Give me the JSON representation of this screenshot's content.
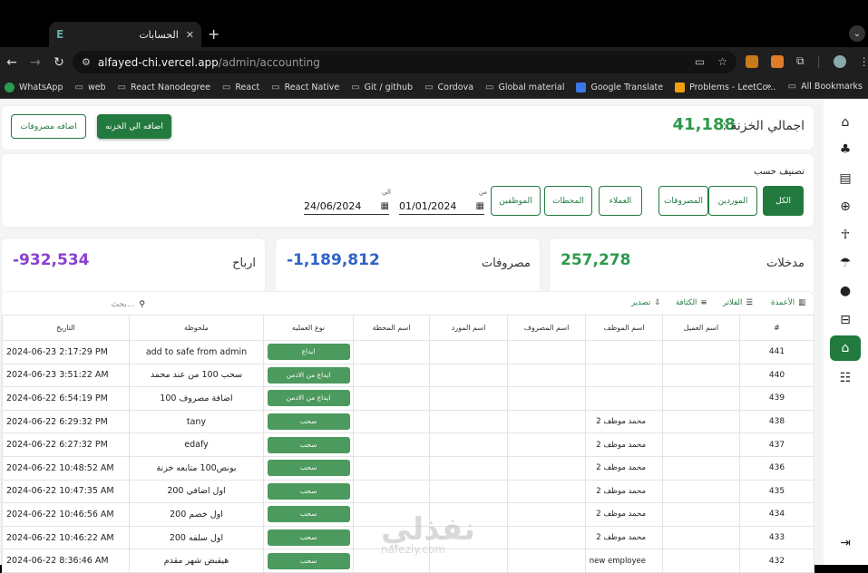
{
  "browser": {
    "tab_title": "الحسابات",
    "tab_favicon": "E",
    "url_host": "alfayed-chi.vercel.app",
    "url_path": "/admin/accounting",
    "bookmarks": [
      "WhatsApp",
      "web",
      "React Nanodegree",
      "React",
      "React Native",
      "Git / github",
      "Cordova",
      "Global material",
      "Google Translate",
      "Problems - LeetCo..."
    ],
    "all_bookmarks": "All Bookmarks"
  },
  "summary": {
    "total_label": "اجمالي الخزنة :",
    "total_value": "41,188",
    "add_treasury": "اضافه الي الخزنه",
    "add_expense": "اضافه مصروفات"
  },
  "filters": {
    "heading": "تصنيف حسب",
    "buttons": [
      "الكل",
      "الموردين",
      "المصروفات",
      "العملاء",
      "المحطات",
      "الموظفين"
    ],
    "from_label": "من",
    "from_date": "01/01/2024",
    "to_label": "الي",
    "to_date": "24/06/2024"
  },
  "stats": {
    "income_label": "مدخلات",
    "income_value": "257,278",
    "income_color": "#2e9a4c",
    "expenses_label": "مصروفات",
    "expenses_value": "-1,189,812",
    "expenses_color": "#2f63c8",
    "profit_label": "ارباح",
    "profit_value": "-932,534",
    "profit_color": "#8a3fd1"
  },
  "table_tools": {
    "columns": "الأعمدة",
    "filters": "الفلاتر",
    "density": "الكثافة",
    "export": "تصدير",
    "search_placeholder": "بحث..."
  },
  "table": {
    "headers": [
      "#",
      "اسم العميل",
      "اسم الموظف",
      "اسم المصروف",
      "اسم المورد",
      "اسم المحطة",
      "نوع العمليه",
      "ملحوظة",
      "التاريخ"
    ],
    "rows": [
      {
        "id": "441",
        "emp": "",
        "type": "ايداع",
        "note": "add to safe from admin",
        "date": "2024-06-23 2:17:29 PM"
      },
      {
        "id": "440",
        "emp": "",
        "type": "ايداع من الادمن",
        "note": "سحب 100 من عند محمد",
        "date": "2024-06-23 3:51:22 AM"
      },
      {
        "id": "439",
        "emp": "",
        "type": "ايداع من الادمن",
        "note": "اضافة مصروف 100",
        "date": "2024-06-22 6:54:19 PM"
      },
      {
        "id": "438",
        "emp": "محمد موظف 2",
        "type": "سحب",
        "note": "tany",
        "date": "2024-06-22 6:29:32 PM"
      },
      {
        "id": "437",
        "emp": "محمد موظف 2",
        "type": "سحب",
        "note": "edafy",
        "date": "2024-06-22 6:27:32 PM"
      },
      {
        "id": "436",
        "emp": "محمد موظف 2",
        "type": "سحب",
        "note": "بونص100 متابعه خزنة",
        "date": "2024-06-22 10:48:52 AM"
      },
      {
        "id": "435",
        "emp": "محمد موظف 2",
        "type": "سحب",
        "note": "اول اضافي 200",
        "date": "2024-06-22 10:47:35 AM"
      },
      {
        "id": "434",
        "emp": "محمد موظف 2",
        "type": "سحب",
        "note": "اول خصم 200",
        "date": "2024-06-22 10:46:56 AM"
      },
      {
        "id": "433",
        "emp": "محمد موظف 2",
        "type": "سحب",
        "note": "اول سلفه 200",
        "date": "2024-06-22 10:46:22 AM"
      },
      {
        "id": "432",
        "emp": "new employee",
        "type": "سحب",
        "note": "هيقبض شهر مقدم",
        "date": "2024-06-22 8:36:46 AM"
      }
    ]
  },
  "watermark": {
    "arabic": "نفذلي",
    "latin": "nafezly.com"
  },
  "sidebar_icons": [
    "home-icon",
    "tree-icon",
    "receipt-icon",
    "plus-circle-icon",
    "hiker-icon",
    "umbrella-icon",
    "user-icon",
    "inbox-icon",
    "bank-icon",
    "group-icon",
    "logout-icon"
  ]
}
